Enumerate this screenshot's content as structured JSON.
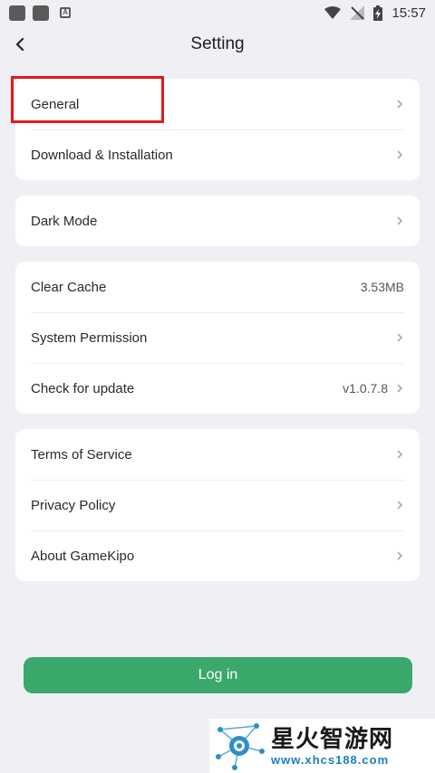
{
  "status_bar": {
    "time": "15:57"
  },
  "header": {
    "title": "Setting"
  },
  "groups": [
    {
      "items": [
        {
          "label": "General"
        },
        {
          "label": "Download & Installation"
        }
      ]
    },
    {
      "items": [
        {
          "label": "Dark Mode"
        }
      ]
    },
    {
      "items": [
        {
          "label": "Clear Cache",
          "value": "3.53MB"
        },
        {
          "label": "System Permission"
        },
        {
          "label": "Check for update",
          "value": "v1.0.7.8"
        }
      ]
    },
    {
      "items": [
        {
          "label": "Terms of Service"
        },
        {
          "label": "Privacy Policy"
        },
        {
          "label": "About GameKipo"
        }
      ]
    }
  ],
  "login_button": {
    "label": "Log in"
  },
  "watermark": {
    "cn_text": "星火智游网",
    "url": "www.xhcs188.com"
  },
  "colors": {
    "accent": "#3aa86b",
    "highlight": "#e21b1b",
    "background": "#eef0f3"
  }
}
